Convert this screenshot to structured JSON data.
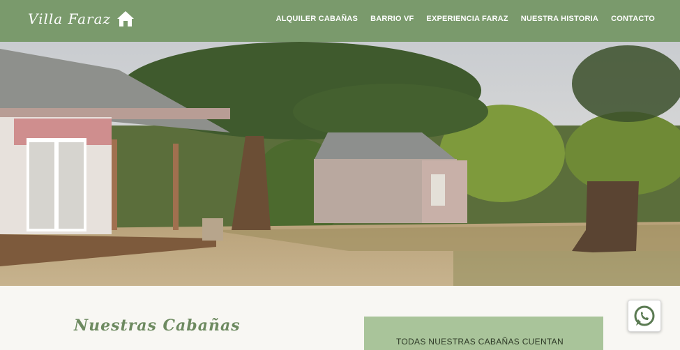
{
  "brand": {
    "name": "Villa Faraz",
    "icon": "home-icon"
  },
  "nav": {
    "items": [
      {
        "label": "ALQUILER CABAÑAS"
      },
      {
        "label": "BARRIO VF"
      },
      {
        "label": "EXPERIENCIA FARAZ"
      },
      {
        "label": "NUESTRA HISTORIA"
      },
      {
        "label": "CONTACTO"
      }
    ]
  },
  "main": {
    "heading": "Nuestras Cabañas",
    "info_box": {
      "text": "TODAS NUESTRAS CABAÑAS CUENTAN"
    }
  },
  "floating": {
    "whatsapp_icon": "whatsapp-icon"
  },
  "colors": {
    "navbar": "#7a9a6c",
    "accent_box": "#a9c49a",
    "heading": "#6d8a60"
  }
}
